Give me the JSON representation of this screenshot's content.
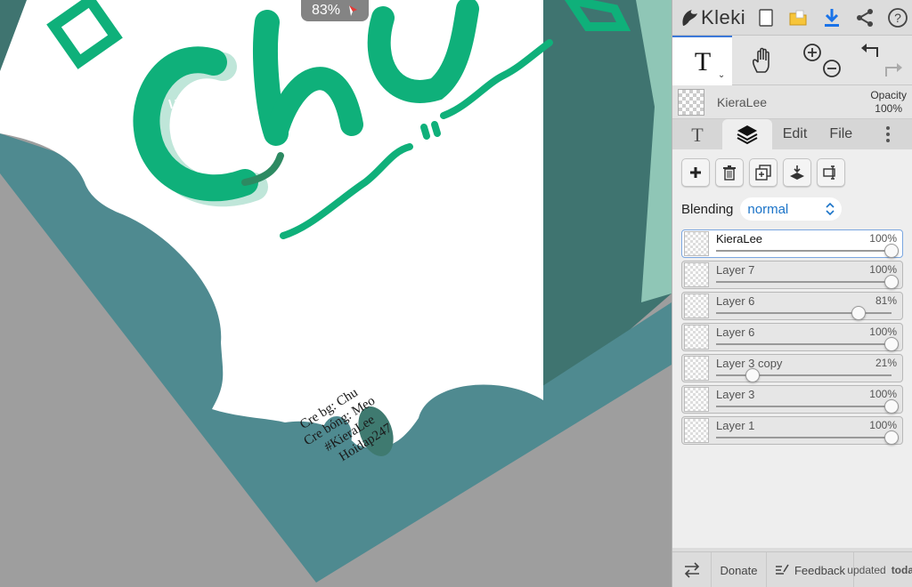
{
  "canvas": {
    "zoom": "83%",
    "artwork_lines": [
      "Cre bg: Chu",
      "Cre bóng: Meo",
      "#KieraLee",
      "Hoidap247"
    ]
  },
  "app": {
    "name": "Kleki"
  },
  "current_layer": {
    "name": "KieraLee",
    "opacity_label": "Opacity",
    "opacity_value": "100%"
  },
  "tabs": {
    "edit": "Edit",
    "file": "File"
  },
  "blending": {
    "label": "Blending",
    "value": "normal"
  },
  "layers": [
    {
      "name": "KieraLee",
      "opacity": "100%",
      "level": 1.0,
      "active": true
    },
    {
      "name": "Layer 7",
      "opacity": "100%",
      "level": 1.0
    },
    {
      "name": "Layer 6",
      "opacity": "81%",
      "level": 0.81
    },
    {
      "name": "Layer 6",
      "opacity": "100%",
      "level": 1.0
    },
    {
      "name": "Layer 3 copy",
      "opacity": "21%",
      "level": 0.21
    },
    {
      "name": "Layer 3",
      "opacity": "100%",
      "level": 1.0
    },
    {
      "name": "Layer 1",
      "opacity": "100%",
      "level": 1.0
    }
  ],
  "footer": {
    "donate": "Donate",
    "feedback": "Feedback",
    "updated_line1": "updated",
    "updated_line2": "today"
  },
  "colors": {
    "accent": "#3c78d8",
    "brand_green": "#0fb07a",
    "teal": "#4f8a90"
  }
}
